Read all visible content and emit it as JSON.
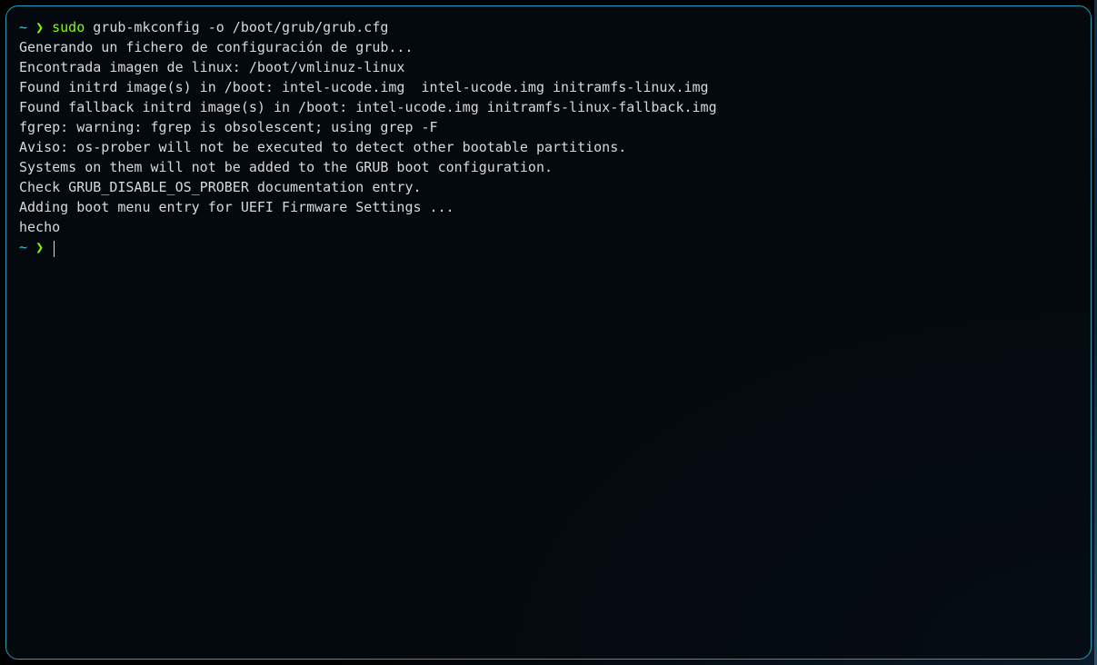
{
  "prompt": {
    "tilde": "~",
    "arrow": "❯"
  },
  "command": {
    "sudo": "sudo",
    "rest": " grub-mkconfig -o /boot/grub/grub.cfg"
  },
  "output_lines": [
    "Generando un fichero de configuración de grub...",
    "Encontrada imagen de linux: /boot/vmlinuz-linux",
    "Found initrd image(s) in /boot: intel-ucode.img  intel-ucode.img initramfs-linux.img",
    "Found fallback initrd image(s) in /boot: intel-ucode.img initramfs-linux-fallback.img",
    "fgrep: warning: fgrep is obsolescent; using grep -F",
    "Aviso: os-prober will not be executed to detect other bootable partitions.",
    "Systems on them will not be added to the GRUB boot configuration.",
    "Check GRUB_DISABLE_OS_PROBER documentation entry.",
    "Adding boot menu entry for UEFI Firmware Settings ...",
    "hecho"
  ]
}
